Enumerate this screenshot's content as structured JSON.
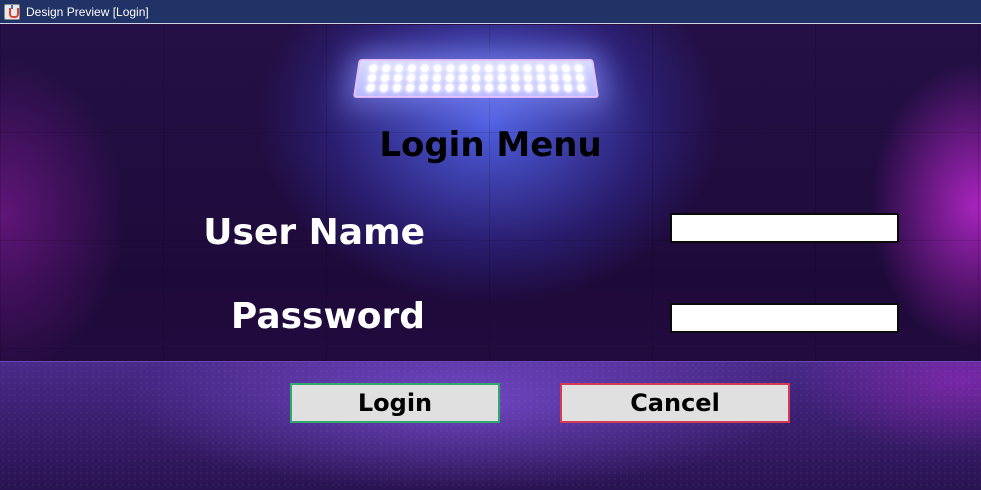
{
  "window": {
    "title": "Design Preview [Login]",
    "icon": "java-cup-icon"
  },
  "form": {
    "heading": "Login Menu",
    "username_label": "User Name",
    "username_value": "",
    "password_label": "Password",
    "password_value": "",
    "login_label": "Login",
    "cancel_label": "Cancel"
  },
  "colors": {
    "titlebar": "#203266",
    "heading": "#000000",
    "labels": "#ffffff",
    "login_border": "#33a86c",
    "cancel_border": "#d23a55",
    "button_face": "#e0e0e0"
  }
}
